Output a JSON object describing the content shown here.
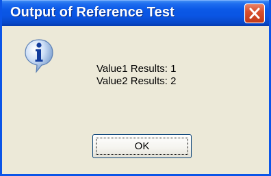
{
  "dialog": {
    "title": "Output of Reference Test",
    "icon": "information-icon",
    "message_lines": [
      "Value1 Results: 1",
      "Value2 Results: 2"
    ],
    "ok_label": "OK",
    "close_icon": "close-icon"
  },
  "colors": {
    "titlebar": "#0a55e3",
    "window_frame": "#0b55e8",
    "dialog_background": "#ece9d8",
    "close_button": "#d8502f",
    "ok_button_border": "#003c74"
  }
}
